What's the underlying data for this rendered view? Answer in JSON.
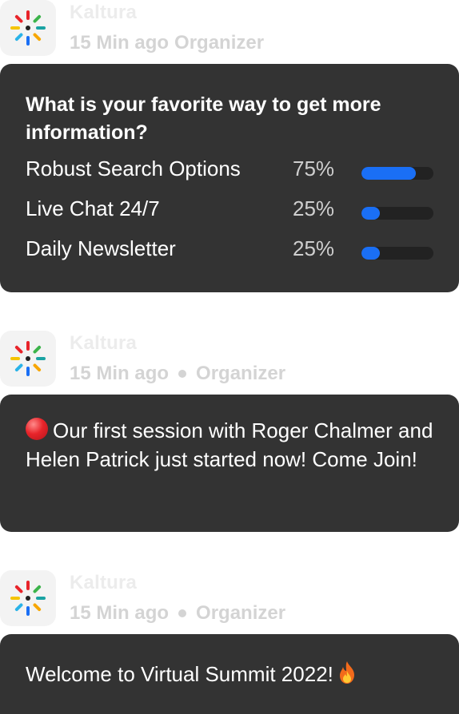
{
  "colors": {
    "card_bg": "#333333",
    "bar_fill": "#1a6ff5",
    "bar_track": "#222222",
    "meta_text": "#d4d4d4"
  },
  "messages": [
    {
      "sender": "Kaltura",
      "time": "15 Min ago",
      "role": "Organizer",
      "logo_icon": "kaltura-logo-icon",
      "poll": {
        "question": "What is your favorite way to get more information?",
        "options": [
          {
            "label": "Robust Search Options",
            "percent_label": "75%",
            "percent": 0.75
          },
          {
            "label": "Live Chat 24/7",
            "percent_label": "25%",
            "percent": 0.25
          },
          {
            "label": "Daily Newsletter",
            "percent_label": "25%",
            "percent": 0.25
          }
        ]
      }
    },
    {
      "sender": "Kaltura",
      "time": "15 Min ago",
      "role": "Organizer",
      "logo_icon": "kaltura-logo-icon",
      "emoji_icon": "red-circle-icon",
      "text": "Our first session with Roger Chalmer and Helen Patrick just started now! Come Join!"
    },
    {
      "sender": "Kaltura",
      "time": "15 Min ago",
      "role": "Organizer",
      "logo_icon": "kaltura-logo-icon",
      "emoji_icon": "fire-icon",
      "text": "Welcome to Virtual Summit 2022!"
    }
  ]
}
